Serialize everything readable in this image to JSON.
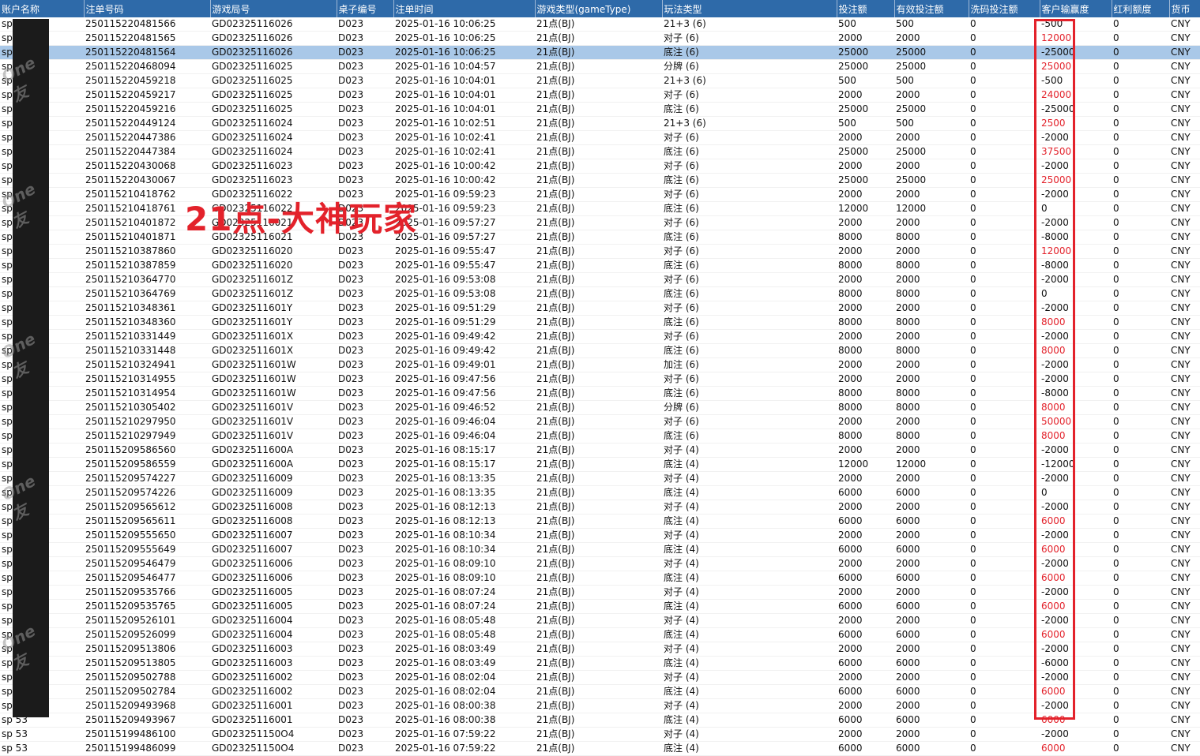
{
  "columns": [
    "账户名称",
    "注单号码",
    "游戏局号",
    "桌子编号",
    "注单时间",
    "游戏类型(gameType)",
    "玩法类型",
    "投注额",
    "有效投注额",
    "洗码投注额",
    "客户输赢度",
    "红利额度",
    "货币"
  ],
  "overlay_text": "21点-大神玩家",
  "watermark_text": "One 友",
  "colors": {
    "header_bg": "#2e6aa9",
    "highlight": "#e3222b",
    "selected_row": "#a9c8e8"
  },
  "selected_row": 2,
  "rows": [
    {
      "acct": "sp 53",
      "bet_no": "250115220481566",
      "round": "GD02325116026",
      "table": "D023",
      "time": "2025-01-16 10:06:25",
      "game": "21点(BJ)",
      "play": "21+3 (6)",
      "bet": "500",
      "valid": "500",
      "wash": "0",
      "win": "-500",
      "bonus": "0",
      "cur": "CNY",
      "neg": true
    },
    {
      "acct": "sp 53",
      "bet_no": "250115220481565",
      "round": "GD02325116026",
      "table": "D023",
      "time": "2025-01-16 10:06:25",
      "game": "21点(BJ)",
      "play": "对子 (6)",
      "bet": "2000",
      "valid": "2000",
      "wash": "0",
      "win": "12000",
      "bonus": "0",
      "cur": "CNY",
      "neg": false
    },
    {
      "acct": "sp 53",
      "bet_no": "250115220481564",
      "round": "GD02325116026",
      "table": "D023",
      "time": "2025-01-16 10:06:25",
      "game": "21点(BJ)",
      "play": "底注 (6)",
      "bet": "25000",
      "valid": "25000",
      "wash": "0",
      "win": "-25000",
      "bonus": "0",
      "cur": "CNY",
      "neg": true
    },
    {
      "acct": "sp 53",
      "bet_no": "250115220468094",
      "round": "GD02325116025",
      "table": "D023",
      "time": "2025-01-16 10:04:57",
      "game": "21点(BJ)",
      "play": "分牌 (6)",
      "bet": "25000",
      "valid": "25000",
      "wash": "0",
      "win": "25000",
      "bonus": "0",
      "cur": "CNY",
      "neg": false
    },
    {
      "acct": "sp 53",
      "bet_no": "250115220459218",
      "round": "GD02325116025",
      "table": "D023",
      "time": "2025-01-16 10:04:01",
      "game": "21点(BJ)",
      "play": "21+3 (6)",
      "bet": "500",
      "valid": "500",
      "wash": "0",
      "win": "-500",
      "bonus": "0",
      "cur": "CNY",
      "neg": true
    },
    {
      "acct": "sp 53",
      "bet_no": "250115220459217",
      "round": "GD02325116025",
      "table": "D023",
      "time": "2025-01-16 10:04:01",
      "game": "21点(BJ)",
      "play": "对子 (6)",
      "bet": "2000",
      "valid": "2000",
      "wash": "0",
      "win": "24000",
      "bonus": "0",
      "cur": "CNY",
      "neg": false
    },
    {
      "acct": "sp 53",
      "bet_no": "250115220459216",
      "round": "GD02325116025",
      "table": "D023",
      "time": "2025-01-16 10:04:01",
      "game": "21点(BJ)",
      "play": "底注 (6)",
      "bet": "25000",
      "valid": "25000",
      "wash": "0",
      "win": "-25000",
      "bonus": "0",
      "cur": "CNY",
      "neg": true
    },
    {
      "acct": "sp 53",
      "bet_no": "250115220449124",
      "round": "GD02325116024",
      "table": "D023",
      "time": "2025-01-16 10:02:51",
      "game": "21点(BJ)",
      "play": "21+3 (6)",
      "bet": "500",
      "valid": "500",
      "wash": "0",
      "win": "2500",
      "bonus": "0",
      "cur": "CNY",
      "neg": false
    },
    {
      "acct": "sp 53",
      "bet_no": "250115220447386",
      "round": "GD02325116024",
      "table": "D023",
      "time": "2025-01-16 10:02:41",
      "game": "21点(BJ)",
      "play": "对子 (6)",
      "bet": "2000",
      "valid": "2000",
      "wash": "0",
      "win": "-2000",
      "bonus": "0",
      "cur": "CNY",
      "neg": true
    },
    {
      "acct": "sp 53",
      "bet_no": "250115220447384",
      "round": "GD02325116024",
      "table": "D023",
      "time": "2025-01-16 10:02:41",
      "game": "21点(BJ)",
      "play": "底注 (6)",
      "bet": "25000",
      "valid": "25000",
      "wash": "0",
      "win": "37500",
      "bonus": "0",
      "cur": "CNY",
      "neg": false
    },
    {
      "acct": "sp 53",
      "bet_no": "250115220430068",
      "round": "GD02325116023",
      "table": "D023",
      "time": "2025-01-16 10:00:42",
      "game": "21点(BJ)",
      "play": "对子 (6)",
      "bet": "2000",
      "valid": "2000",
      "wash": "0",
      "win": "-2000",
      "bonus": "0",
      "cur": "CNY",
      "neg": true
    },
    {
      "acct": "sp 53",
      "bet_no": "250115220430067",
      "round": "GD02325116023",
      "table": "D023",
      "time": "2025-01-16 10:00:42",
      "game": "21点(BJ)",
      "play": "底注 (6)",
      "bet": "25000",
      "valid": "25000",
      "wash": "0",
      "win": "25000",
      "bonus": "0",
      "cur": "CNY",
      "neg": false
    },
    {
      "acct": "sp 53",
      "bet_no": "250115210418762",
      "round": "GD02325116022",
      "table": "D023",
      "time": "2025-01-16 09:59:23",
      "game": "21点(BJ)",
      "play": "对子 (6)",
      "bet": "2000",
      "valid": "2000",
      "wash": "0",
      "win": "-2000",
      "bonus": "0",
      "cur": "CNY",
      "neg": true
    },
    {
      "acct": "sp 53",
      "bet_no": "250115210418761",
      "round": "GD02325116022",
      "table": "D023",
      "time": "2025-01-16 09:59:23",
      "game": "21点(BJ)",
      "play": "底注 (6)",
      "bet": "12000",
      "valid": "12000",
      "wash": "0",
      "win": "0",
      "bonus": "0",
      "cur": "CNY",
      "neg": true
    },
    {
      "acct": "sp 53",
      "bet_no": "250115210401872",
      "round": "GD02325116021",
      "table": "D023",
      "time": "2025-01-16 09:57:27",
      "game": "21点(BJ)",
      "play": "对子 (6)",
      "bet": "2000",
      "valid": "2000",
      "wash": "0",
      "win": "-2000",
      "bonus": "0",
      "cur": "CNY",
      "neg": true
    },
    {
      "acct": "sp 53",
      "bet_no": "250115210401871",
      "round": "GD02325116021",
      "table": "D023",
      "time": "2025-01-16 09:57:27",
      "game": "21点(BJ)",
      "play": "底注 (6)",
      "bet": "8000",
      "valid": "8000",
      "wash": "0",
      "win": "-8000",
      "bonus": "0",
      "cur": "CNY",
      "neg": true
    },
    {
      "acct": "sp 53",
      "bet_no": "250115210387860",
      "round": "GD02325116020",
      "table": "D023",
      "time": "2025-01-16 09:55:47",
      "game": "21点(BJ)",
      "play": "对子 (6)",
      "bet": "2000",
      "valid": "2000",
      "wash": "0",
      "win": "12000",
      "bonus": "0",
      "cur": "CNY",
      "neg": false
    },
    {
      "acct": "sp 53",
      "bet_no": "250115210387859",
      "round": "GD02325116020",
      "table": "D023",
      "time": "2025-01-16 09:55:47",
      "game": "21点(BJ)",
      "play": "底注 (6)",
      "bet": "8000",
      "valid": "8000",
      "wash": "0",
      "win": "-8000",
      "bonus": "0",
      "cur": "CNY",
      "neg": true
    },
    {
      "acct": "sp 53",
      "bet_no": "250115210364770",
      "round": "GD0232511601Z",
      "table": "D023",
      "time": "2025-01-16 09:53:08",
      "game": "21点(BJ)",
      "play": "对子 (6)",
      "bet": "2000",
      "valid": "2000",
      "wash": "0",
      "win": "-2000",
      "bonus": "0",
      "cur": "CNY",
      "neg": true
    },
    {
      "acct": "sp 53",
      "bet_no": "250115210364769",
      "round": "GD0232511601Z",
      "table": "D023",
      "time": "2025-01-16 09:53:08",
      "game": "21点(BJ)",
      "play": "底注 (6)",
      "bet": "8000",
      "valid": "8000",
      "wash": "0",
      "win": "0",
      "bonus": "0",
      "cur": "CNY",
      "neg": true
    },
    {
      "acct": "sp 53",
      "bet_no": "250115210348361",
      "round": "GD0232511601Y",
      "table": "D023",
      "time": "2025-01-16 09:51:29",
      "game": "21点(BJ)",
      "play": "对子 (6)",
      "bet": "2000",
      "valid": "2000",
      "wash": "0",
      "win": "-2000",
      "bonus": "0",
      "cur": "CNY",
      "neg": true
    },
    {
      "acct": "sp 53",
      "bet_no": "250115210348360",
      "round": "GD0232511601Y",
      "table": "D023",
      "time": "2025-01-16 09:51:29",
      "game": "21点(BJ)",
      "play": "底注 (6)",
      "bet": "8000",
      "valid": "8000",
      "wash": "0",
      "win": "8000",
      "bonus": "0",
      "cur": "CNY",
      "neg": false
    },
    {
      "acct": "sp 53",
      "bet_no": "250115210331449",
      "round": "GD0232511601X",
      "table": "D023",
      "time": "2025-01-16 09:49:42",
      "game": "21点(BJ)",
      "play": "对子 (6)",
      "bet": "2000",
      "valid": "2000",
      "wash": "0",
      "win": "-2000",
      "bonus": "0",
      "cur": "CNY",
      "neg": true
    },
    {
      "acct": "sp 53",
      "bet_no": "250115210331448",
      "round": "GD0232511601X",
      "table": "D023",
      "time": "2025-01-16 09:49:42",
      "game": "21点(BJ)",
      "play": "底注 (6)",
      "bet": "8000",
      "valid": "8000",
      "wash": "0",
      "win": "8000",
      "bonus": "0",
      "cur": "CNY",
      "neg": false
    },
    {
      "acct": "sp 53",
      "bet_no": "250115210324941",
      "round": "GD0232511601W",
      "table": "D023",
      "time": "2025-01-16 09:49:01",
      "game": "21点(BJ)",
      "play": "加注 (6)",
      "bet": "2000",
      "valid": "2000",
      "wash": "0",
      "win": "-2000",
      "bonus": "0",
      "cur": "CNY",
      "neg": true
    },
    {
      "acct": "sp 53",
      "bet_no": "250115210314955",
      "round": "GD0232511601W",
      "table": "D023",
      "time": "2025-01-16 09:47:56",
      "game": "21点(BJ)",
      "play": "对子 (6)",
      "bet": "2000",
      "valid": "2000",
      "wash": "0",
      "win": "-2000",
      "bonus": "0",
      "cur": "CNY",
      "neg": true
    },
    {
      "acct": "sp 53",
      "bet_no": "250115210314954",
      "round": "GD0232511601W",
      "table": "D023",
      "time": "2025-01-16 09:47:56",
      "game": "21点(BJ)",
      "play": "底注 (6)",
      "bet": "8000",
      "valid": "8000",
      "wash": "0",
      "win": "-8000",
      "bonus": "0",
      "cur": "CNY",
      "neg": true
    },
    {
      "acct": "sp 53",
      "bet_no": "250115210305402",
      "round": "GD0232511601V",
      "table": "D023",
      "time": "2025-01-16 09:46:52",
      "game": "21点(BJ)",
      "play": "分牌 (6)",
      "bet": "8000",
      "valid": "8000",
      "wash": "0",
      "win": "8000",
      "bonus": "0",
      "cur": "CNY",
      "neg": false
    },
    {
      "acct": "sp 53",
      "bet_no": "250115210297950",
      "round": "GD0232511601V",
      "table": "D023",
      "time": "2025-01-16 09:46:04",
      "game": "21点(BJ)",
      "play": "对子 (6)",
      "bet": "2000",
      "valid": "2000",
      "wash": "0",
      "win": "50000",
      "bonus": "0",
      "cur": "CNY",
      "neg": false
    },
    {
      "acct": "sp 53",
      "bet_no": "250115210297949",
      "round": "GD0232511601V",
      "table": "D023",
      "time": "2025-01-16 09:46:04",
      "game": "21点(BJ)",
      "play": "底注 (6)",
      "bet": "8000",
      "valid": "8000",
      "wash": "0",
      "win": "8000",
      "bonus": "0",
      "cur": "CNY",
      "neg": false
    },
    {
      "acct": "sp 53",
      "bet_no": "250115209586560",
      "round": "GD0232511600A",
      "table": "D023",
      "time": "2025-01-16 08:15:17",
      "game": "21点(BJ)",
      "play": "对子 (4)",
      "bet": "2000",
      "valid": "2000",
      "wash": "0",
      "win": "-2000",
      "bonus": "0",
      "cur": "CNY",
      "neg": true
    },
    {
      "acct": "sp 53",
      "bet_no": "250115209586559",
      "round": "GD0232511600A",
      "table": "D023",
      "time": "2025-01-16 08:15:17",
      "game": "21点(BJ)",
      "play": "底注 (4)",
      "bet": "12000",
      "valid": "12000",
      "wash": "0",
      "win": "-12000",
      "bonus": "0",
      "cur": "CNY",
      "neg": true
    },
    {
      "acct": "sp 53",
      "bet_no": "250115209574227",
      "round": "GD02325116009",
      "table": "D023",
      "time": "2025-01-16 08:13:35",
      "game": "21点(BJ)",
      "play": "对子 (4)",
      "bet": "2000",
      "valid": "2000",
      "wash": "0",
      "win": "-2000",
      "bonus": "0",
      "cur": "CNY",
      "neg": true
    },
    {
      "acct": "sp 53",
      "bet_no": "250115209574226",
      "round": "GD02325116009",
      "table": "D023",
      "time": "2025-01-16 08:13:35",
      "game": "21点(BJ)",
      "play": "底注 (4)",
      "bet": "6000",
      "valid": "6000",
      "wash": "0",
      "win": "0",
      "bonus": "0",
      "cur": "CNY",
      "neg": true
    },
    {
      "acct": "sp 53",
      "bet_no": "250115209565612",
      "round": "GD02325116008",
      "table": "D023",
      "time": "2025-01-16 08:12:13",
      "game": "21点(BJ)",
      "play": "对子 (4)",
      "bet": "2000",
      "valid": "2000",
      "wash": "0",
      "win": "-2000",
      "bonus": "0",
      "cur": "CNY",
      "neg": true
    },
    {
      "acct": "sp 53",
      "bet_no": "250115209565611",
      "round": "GD02325116008",
      "table": "D023",
      "time": "2025-01-16 08:12:13",
      "game": "21点(BJ)",
      "play": "底注 (4)",
      "bet": "6000",
      "valid": "6000",
      "wash": "0",
      "win": "6000",
      "bonus": "0",
      "cur": "CNY",
      "neg": false
    },
    {
      "acct": "sp 53",
      "bet_no": "250115209555650",
      "round": "GD02325116007",
      "table": "D023",
      "time": "2025-01-16 08:10:34",
      "game": "21点(BJ)",
      "play": "对子 (4)",
      "bet": "2000",
      "valid": "2000",
      "wash": "0",
      "win": "-2000",
      "bonus": "0",
      "cur": "CNY",
      "neg": true
    },
    {
      "acct": "sp 53",
      "bet_no": "250115209555649",
      "round": "GD02325116007",
      "table": "D023",
      "time": "2025-01-16 08:10:34",
      "game": "21点(BJ)",
      "play": "底注 (4)",
      "bet": "6000",
      "valid": "6000",
      "wash": "0",
      "win": "6000",
      "bonus": "0",
      "cur": "CNY",
      "neg": false
    },
    {
      "acct": "sp 53",
      "bet_no": "250115209546479",
      "round": "GD02325116006",
      "table": "D023",
      "time": "2025-01-16 08:09:10",
      "game": "21点(BJ)",
      "play": "对子 (4)",
      "bet": "2000",
      "valid": "2000",
      "wash": "0",
      "win": "-2000",
      "bonus": "0",
      "cur": "CNY",
      "neg": true
    },
    {
      "acct": "sp 53",
      "bet_no": "250115209546477",
      "round": "GD02325116006",
      "table": "D023",
      "time": "2025-01-16 08:09:10",
      "game": "21点(BJ)",
      "play": "底注 (4)",
      "bet": "6000",
      "valid": "6000",
      "wash": "0",
      "win": "6000",
      "bonus": "0",
      "cur": "CNY",
      "neg": false
    },
    {
      "acct": "sp 53",
      "bet_no": "250115209535766",
      "round": "GD02325116005",
      "table": "D023",
      "time": "2025-01-16 08:07:24",
      "game": "21点(BJ)",
      "play": "对子 (4)",
      "bet": "2000",
      "valid": "2000",
      "wash": "0",
      "win": "-2000",
      "bonus": "0",
      "cur": "CNY",
      "neg": true
    },
    {
      "acct": "sp 53",
      "bet_no": "250115209535765",
      "round": "GD02325116005",
      "table": "D023",
      "time": "2025-01-16 08:07:24",
      "game": "21点(BJ)",
      "play": "底注 (4)",
      "bet": "6000",
      "valid": "6000",
      "wash": "0",
      "win": "6000",
      "bonus": "0",
      "cur": "CNY",
      "neg": false
    },
    {
      "acct": "sp 53",
      "bet_no": "250115209526101",
      "round": "GD02325116004",
      "table": "D023",
      "time": "2025-01-16 08:05:48",
      "game": "21点(BJ)",
      "play": "对子 (4)",
      "bet": "2000",
      "valid": "2000",
      "wash": "0",
      "win": "-2000",
      "bonus": "0",
      "cur": "CNY",
      "neg": true
    },
    {
      "acct": "sp 53",
      "bet_no": "250115209526099",
      "round": "GD02325116004",
      "table": "D023",
      "time": "2025-01-16 08:05:48",
      "game": "21点(BJ)",
      "play": "底注 (4)",
      "bet": "6000",
      "valid": "6000",
      "wash": "0",
      "win": "6000",
      "bonus": "0",
      "cur": "CNY",
      "neg": false
    },
    {
      "acct": "sp 53",
      "bet_no": "250115209513806",
      "round": "GD02325116003",
      "table": "D023",
      "time": "2025-01-16 08:03:49",
      "game": "21点(BJ)",
      "play": "对子 (4)",
      "bet": "2000",
      "valid": "2000",
      "wash": "0",
      "win": "-2000",
      "bonus": "0",
      "cur": "CNY",
      "neg": true
    },
    {
      "acct": "sp 53",
      "bet_no": "250115209513805",
      "round": "GD02325116003",
      "table": "D023",
      "time": "2025-01-16 08:03:49",
      "game": "21点(BJ)",
      "play": "底注 (4)",
      "bet": "6000",
      "valid": "6000",
      "wash": "0",
      "win": "-6000",
      "bonus": "0",
      "cur": "CNY",
      "neg": true
    },
    {
      "acct": "sp 53",
      "bet_no": "250115209502788",
      "round": "GD02325116002",
      "table": "D023",
      "time": "2025-01-16 08:02:04",
      "game": "21点(BJ)",
      "play": "对子 (4)",
      "bet": "2000",
      "valid": "2000",
      "wash": "0",
      "win": "-2000",
      "bonus": "0",
      "cur": "CNY",
      "neg": true
    },
    {
      "acct": "sp 53",
      "bet_no": "250115209502784",
      "round": "GD02325116002",
      "table": "D023",
      "time": "2025-01-16 08:02:04",
      "game": "21点(BJ)",
      "play": "底注 (4)",
      "bet": "6000",
      "valid": "6000",
      "wash": "0",
      "win": "6000",
      "bonus": "0",
      "cur": "CNY",
      "neg": false
    },
    {
      "acct": "sp 53",
      "bet_no": "250115209493968",
      "round": "GD02325116001",
      "table": "D023",
      "time": "2025-01-16 08:00:38",
      "game": "21点(BJ)",
      "play": "对子 (4)",
      "bet": "2000",
      "valid": "2000",
      "wash": "0",
      "win": "-2000",
      "bonus": "0",
      "cur": "CNY",
      "neg": true
    },
    {
      "acct": "sp 53",
      "bet_no": "250115209493967",
      "round": "GD02325116001",
      "table": "D023",
      "time": "2025-01-16 08:00:38",
      "game": "21点(BJ)",
      "play": "底注 (4)",
      "bet": "6000",
      "valid": "6000",
      "wash": "0",
      "win": "6000",
      "bonus": "0",
      "cur": "CNY",
      "neg": false
    },
    {
      "acct": "sp 53",
      "bet_no": "250115199486100",
      "round": "GD023251150O4",
      "table": "D023",
      "time": "2025-01-16 07:59:22",
      "game": "21点(BJ)",
      "play": "对子 (4)",
      "bet": "2000",
      "valid": "2000",
      "wash": "0",
      "win": "-2000",
      "bonus": "0",
      "cur": "CNY",
      "neg": true
    },
    {
      "acct": "sp 53",
      "bet_no": "250115199486099",
      "round": "GD023251150O4",
      "table": "D023",
      "time": "2025-01-16 07:59:22",
      "game": "21点(BJ)",
      "play": "底注 (4)",
      "bet": "6000",
      "valid": "6000",
      "wash": "0",
      "win": "6000",
      "bonus": "0",
      "cur": "CNY",
      "neg": false
    }
  ]
}
